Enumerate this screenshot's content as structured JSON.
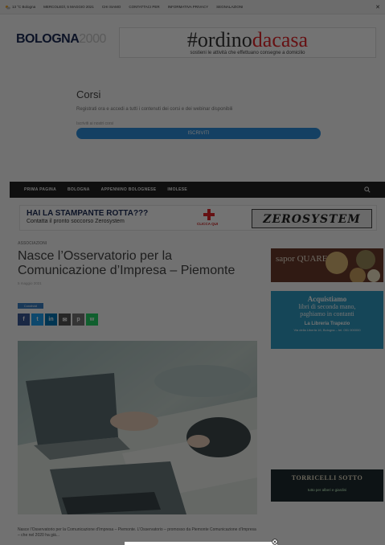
{
  "topbar": {
    "weather": "13 °C Bologna",
    "links": [
      "MERCOLEDÌ, 5 MAGGIO 2021",
      "CHI SIAMO",
      "CONTATTACI PER",
      "INFORMATIVA PRIVACY",
      "SEGNALAZIONI"
    ]
  },
  "brand": {
    "logo_main": "BOLOGNA",
    "logo_light": "2000"
  },
  "top_banner": {
    "word1": "#ordino",
    "word2": "da",
    "word3": "casa",
    "subtitle": "sostieni le attività che effettuano consegne a domicilio"
  },
  "corsi": {
    "title": "Corsi",
    "text": "Registrati ora e accedi a tutti i contenuti dei corsi e dei webinar disponibili",
    "small": "Iscriviti ai nostri corsi",
    "cta": "ISCRIVITI"
  },
  "nav": {
    "items": [
      "PRIMA PAGINA",
      "BOLOGNA",
      "APPENNINO BOLOGNESE",
      "IMOLESE"
    ]
  },
  "ad_printer": {
    "headline": "HAI LA STAMPANTE ROTTA???",
    "subline": "Contatta il pronto soccorso Zerosystem",
    "cta": "CLICCA QUI",
    "brand": "ZEROSYSTEM"
  },
  "article": {
    "category": "ASSOCIAZIONI",
    "title": "Nasce l’Osservatorio per la Comunicazione d’Impresa – Piemonte",
    "date": "5 maggio 2021",
    "share_label": "Condividi",
    "caption": "Nasce l’Osservatorio per la Comunicazione d’Impresa – Piemonte. L’Osservatorio – promosso da Piemonte Comunicazione d’Impresa – che nel 2020 ha già..."
  },
  "share_buttons": [
    {
      "label": "f",
      "color": "#3b5998"
    },
    {
      "label": "t",
      "color": "#1da1f2"
    },
    {
      "label": "in",
      "color": "#0077b5"
    },
    {
      "label": "✉",
      "color": "#555555"
    },
    {
      "label": "p",
      "color": "#777777"
    },
    {
      "label": "w",
      "color": "#25d366"
    }
  ],
  "sidebar": {
    "ad1": "sapor QUARE",
    "ad2_line1": "Acquistiamo",
    "ad2_line2": "libri di seconda mano,",
    "ad2_line3": "paghiamo in contanti",
    "ad2_name": "La Libreria Trapezio",
    "ad2_small": "Via della Libertà 16, Bologna – tel. 051 000000",
    "ad3_title": "TORRICELLI SOTTO",
    "ad3_sub": "tutto per alberi e giardini"
  }
}
